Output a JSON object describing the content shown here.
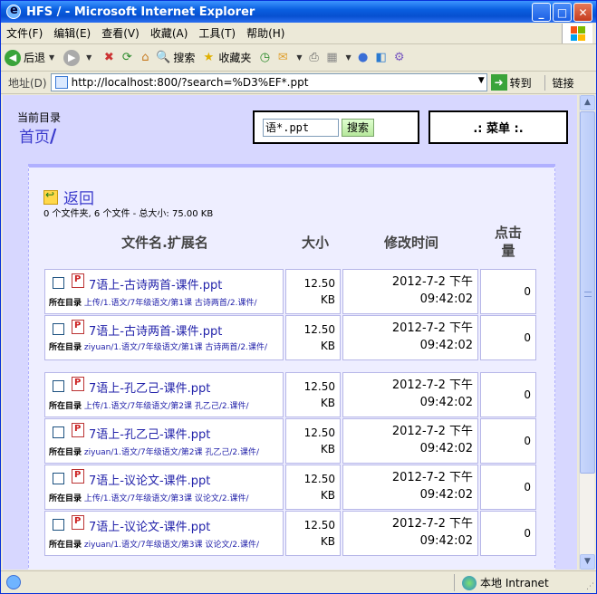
{
  "window": {
    "title": "HFS / - Microsoft Internet Explorer"
  },
  "menu": [
    "文件(F)",
    "编辑(E)",
    "查看(V)",
    "收藏(A)",
    "工具(T)",
    "帮助(H)"
  ],
  "toolbar": {
    "back": "后退",
    "search": "搜索",
    "favorites": "收藏夹"
  },
  "address": {
    "label": "地址(D)",
    "url": "http://localhost:800/?search=%D3%EF*.ppt",
    "go": "转到",
    "links": "链接"
  },
  "page": {
    "current_dir_label": "当前目录",
    "home": "首页",
    "search_value": "语*.ppt",
    "search_button": "搜索",
    "menu_label": ".: 菜单 :.",
    "back": "返回",
    "summary": "0 个文件夹, 6 个文件 - 总大小: 75.00 KB",
    "columns": [
      "文件名.扩展名",
      "大小",
      "修改时间",
      "点击量"
    ],
    "loc_label": "所在目录",
    "files": [
      {
        "name": "7语上-古诗两首-课件.ppt",
        "loc": "上传/1.语文/7年级语文/第1课 古诗两首/2.课件/",
        "size": "12.50 KB",
        "date": "2012-7-2 下午",
        "time": "09:42:02",
        "hits": "0"
      },
      {
        "name": "7语上-古诗两首-课件.ppt",
        "loc": "ziyuan/1.语文/7年级语文/第1课 古诗两首/2.课件/",
        "size": "12.50 KB",
        "date": "2012-7-2 下午",
        "time": "09:42:02",
        "hits": "0"
      },
      {
        "name": "7语上-孔乙己-课件.ppt",
        "loc": "上传/1.语文/7年级语文/第2课 孔乙己/2.课件/",
        "size": "12.50 KB",
        "date": "2012-7-2 下午",
        "time": "09:42:02",
        "hits": "0"
      },
      {
        "name": "7语上-孔乙己-课件.ppt",
        "loc": "ziyuan/1.语文/7年级语文/第2课 孔乙己/2.课件/",
        "size": "12.50 KB",
        "date": "2012-7-2 下午",
        "time": "09:42:02",
        "hits": "0"
      },
      {
        "name": "7语上-议论文-课件.ppt",
        "loc": "上传/1.语文/7年级语文/第3课 议论文/2.课件/",
        "size": "12.50 KB",
        "date": "2012-7-2 下午",
        "time": "09:42:02",
        "hits": "0"
      },
      {
        "name": "7语上-议论文-课件.ppt",
        "loc": "ziyuan/1.语文/7年级语文/第3课 议论文/2.课件/",
        "size": "12.50 KB",
        "date": "2012-7-2 下午",
        "time": "09:42:02",
        "hits": "0"
      }
    ]
  },
  "status": {
    "zone": "本地 Intranet"
  }
}
